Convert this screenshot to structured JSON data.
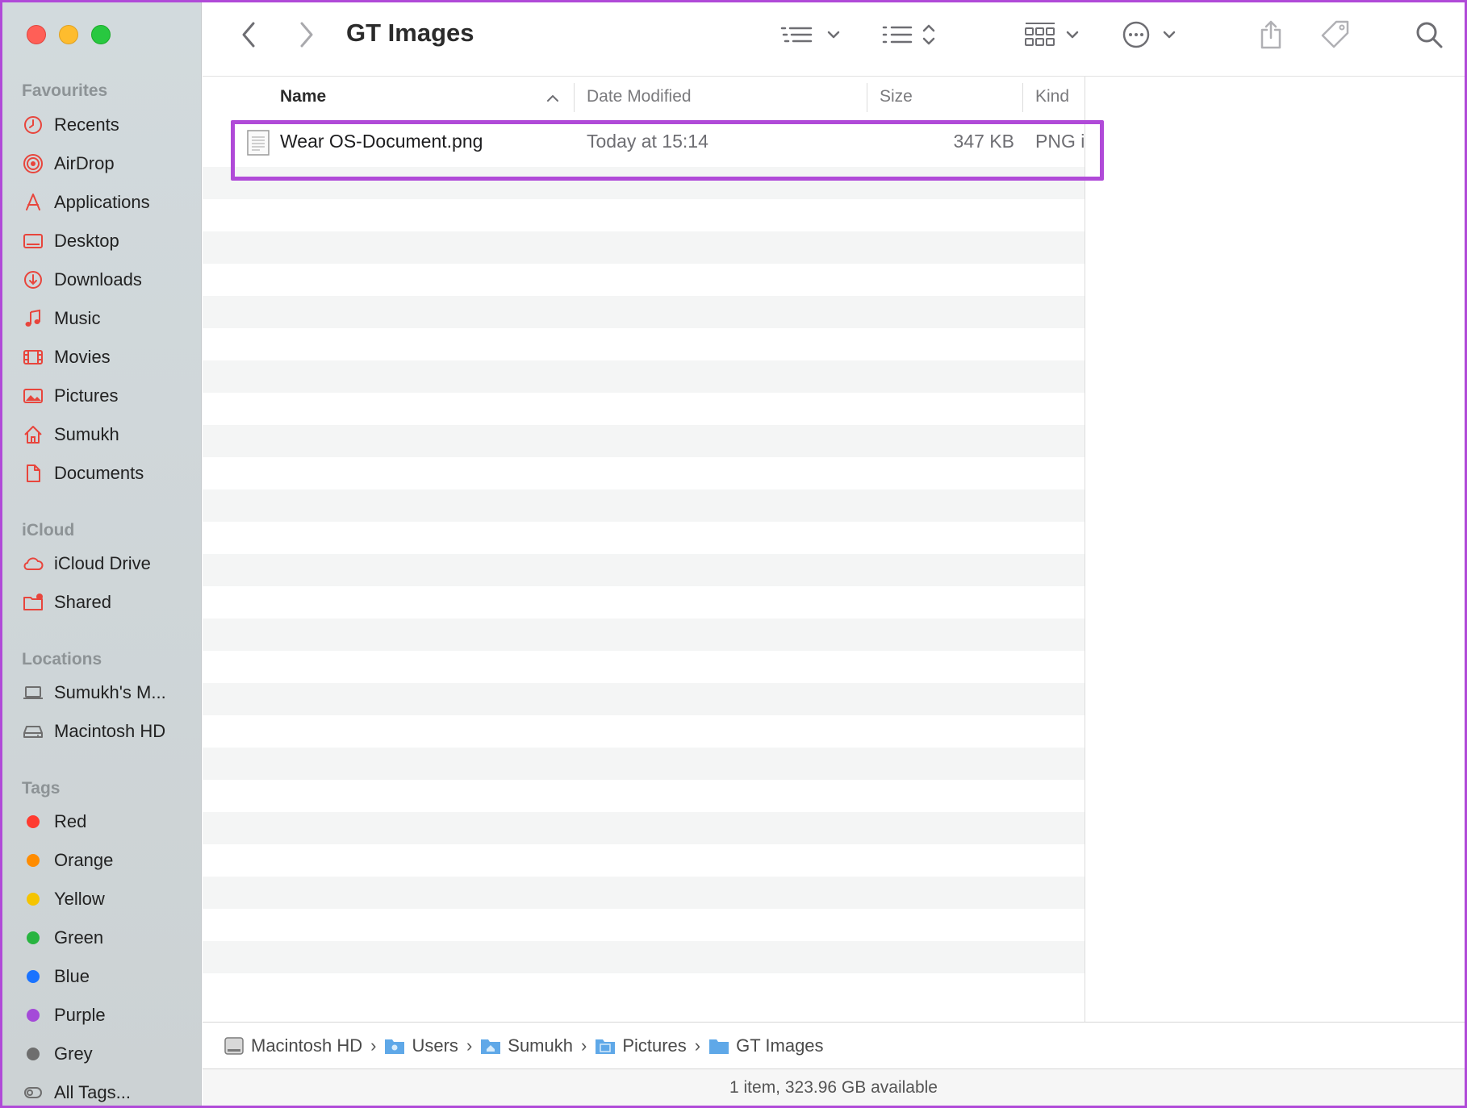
{
  "window": {
    "title": "GT Images"
  },
  "sidebar": {
    "favourites_title": "Favourites",
    "favourites": [
      {
        "label": "Recents",
        "icon": "clock-icon"
      },
      {
        "label": "AirDrop",
        "icon": "airdrop-icon"
      },
      {
        "label": "Applications",
        "icon": "applications-icon"
      },
      {
        "label": "Desktop",
        "icon": "desktop-icon"
      },
      {
        "label": "Downloads",
        "icon": "download-icon"
      },
      {
        "label": "Music",
        "icon": "music-note-icon"
      },
      {
        "label": "Movies",
        "icon": "film-icon"
      },
      {
        "label": "Pictures",
        "icon": "photo-icon"
      },
      {
        "label": "Sumukh",
        "icon": "home-icon"
      },
      {
        "label": "Documents",
        "icon": "document-icon"
      }
    ],
    "icloud_title": "iCloud",
    "icloud": [
      {
        "label": "iCloud Drive",
        "icon": "cloud-icon"
      },
      {
        "label": "Shared",
        "icon": "shared-folder-icon"
      }
    ],
    "locations_title": "Locations",
    "locations": [
      {
        "label": "Sumukh's M...",
        "icon": "laptop-icon"
      },
      {
        "label": "Macintosh HD",
        "icon": "hard-drive-icon"
      }
    ],
    "tags_title": "Tags",
    "tags": [
      {
        "label": "Red",
        "color": "#ff3b30"
      },
      {
        "label": "Orange",
        "color": "#ff8c00"
      },
      {
        "label": "Yellow",
        "color": "#f5c400"
      },
      {
        "label": "Green",
        "color": "#28b440"
      },
      {
        "label": "Blue",
        "color": "#1a73ff"
      },
      {
        "label": "Purple",
        "color": "#a44ad8"
      },
      {
        "label": "Grey",
        "color": "#6e6e6e"
      },
      {
        "label": "All Tags...",
        "color": ""
      }
    ],
    "accent_icon_color": "#e8453c"
  },
  "columns": {
    "name": "Name",
    "date_modified": "Date Modified",
    "size": "Size",
    "kind": "Kind"
  },
  "files": [
    {
      "name": "Wear OS-Document.png",
      "date_modified": "Today at 15:14",
      "size": "347 KB",
      "kind": "PNG i"
    }
  ],
  "pathbar": [
    {
      "label": "Macintosh HD",
      "icon": "hard-drive-icon"
    },
    {
      "label": "Users",
      "icon": "folder-icon"
    },
    {
      "label": "Sumukh",
      "icon": "home-folder-icon"
    },
    {
      "label": "Pictures",
      "icon": "pictures-folder-icon"
    },
    {
      "label": "GT Images",
      "icon": "folder-icon"
    }
  ],
  "status": "1 item, 323.96 GB available",
  "highlight_color": "#b04ad8"
}
